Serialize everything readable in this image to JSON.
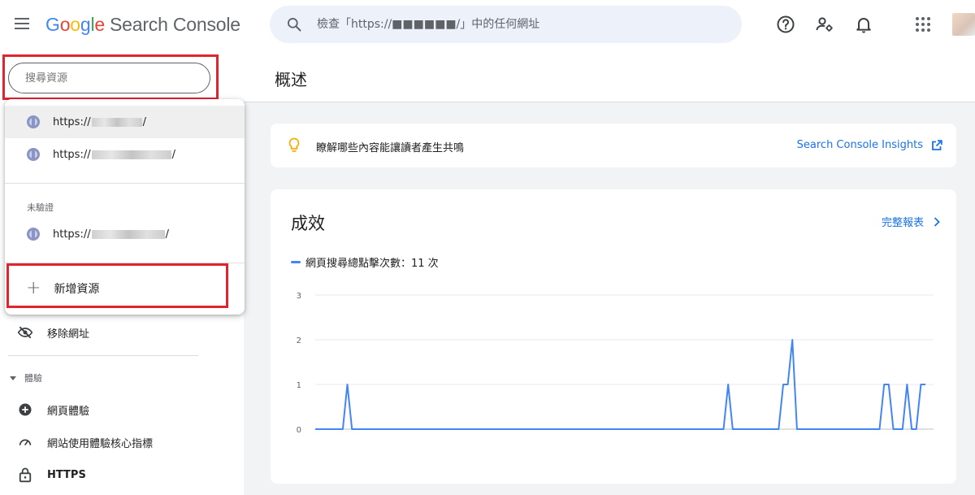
{
  "header": {
    "brand": {
      "letters": [
        "G",
        "o",
        "o",
        "g",
        "l",
        "e"
      ],
      "product": "Search Console"
    },
    "search": {
      "placeholder": "檢查「https://■■■■■■/」中的任何網址"
    },
    "icons": [
      "menu-icon",
      "search-icon",
      "help-icon",
      "manage-users-icon",
      "notifications-icon",
      "apps-grid-icon",
      "account-avatar"
    ]
  },
  "sidebar": {
    "property_search_placeholder": "搜尋資源",
    "dropdown": {
      "verified": [
        {
          "prefix": "https://",
          "suffix": "/"
        },
        {
          "prefix": "https://",
          "suffix": "/"
        }
      ],
      "unverified_label": "未驗證",
      "unverified": [
        {
          "prefix": "https://",
          "suffix": "/"
        }
      ],
      "add_property": "新增資源"
    },
    "items": [
      {
        "label": "移除網址",
        "icon": "eye-off-icon"
      }
    ],
    "section_experience": "體驗",
    "experience_items": [
      {
        "label": "網頁體驗",
        "icon": "plus-circle-icon"
      },
      {
        "label": "網站使用體驗核心指標",
        "icon": "speedometer-icon"
      },
      {
        "label": "HTTPS",
        "icon": "lock-icon"
      }
    ]
  },
  "main": {
    "title": "概述",
    "insight": {
      "text": "瞭解哪些內容能讓讀者產生共鳴",
      "link": "Search Console Insights"
    },
    "performance": {
      "title": "成效",
      "full_report": "完整報表",
      "legend": "網頁搜尋總點擊次數：11 次"
    }
  },
  "colors": {
    "accent": "#1a73e8",
    "line": "#4285f4",
    "highlight_box": "#e0252f"
  },
  "chart_data": {
    "type": "line",
    "series": [
      {
        "name": "網頁搜尋總點擊次數：11 次",
        "values": [
          0,
          0,
          0,
          0,
          0,
          0,
          0,
          1,
          0,
          0,
          0,
          0,
          0,
          0,
          0,
          0,
          0,
          0,
          0,
          0,
          0,
          0,
          0,
          0,
          0,
          0,
          0,
          0,
          0,
          0,
          0,
          0,
          0,
          0,
          0,
          0,
          0,
          0,
          0,
          0,
          0,
          0,
          0,
          0,
          0,
          0,
          0,
          0,
          0,
          0,
          0,
          0,
          0,
          0,
          0,
          0,
          0,
          0,
          0,
          0,
          0,
          0,
          0,
          0,
          0,
          0,
          0,
          0,
          0,
          0,
          0,
          0,
          0,
          0,
          0,
          0,
          0,
          0,
          0,
          0,
          0,
          0,
          0,
          0,
          0,
          0,
          0,
          0,
          0,
          0,
          1,
          0,
          0,
          0,
          0,
          0,
          0,
          0,
          0,
          0,
          0,
          0,
          1,
          1,
          2,
          0,
          0,
          0,
          0,
          0,
          0,
          0,
          0,
          0,
          0,
          0,
          0,
          0,
          0,
          0,
          0,
          0,
          0,
          0,
          1,
          1,
          0,
          0,
          0,
          1,
          0,
          0,
          1,
          1
        ]
      }
    ],
    "yticks": [
      0,
      1,
      2,
      3
    ],
    "ylim": [
      0,
      3
    ],
    "grid": true
  }
}
